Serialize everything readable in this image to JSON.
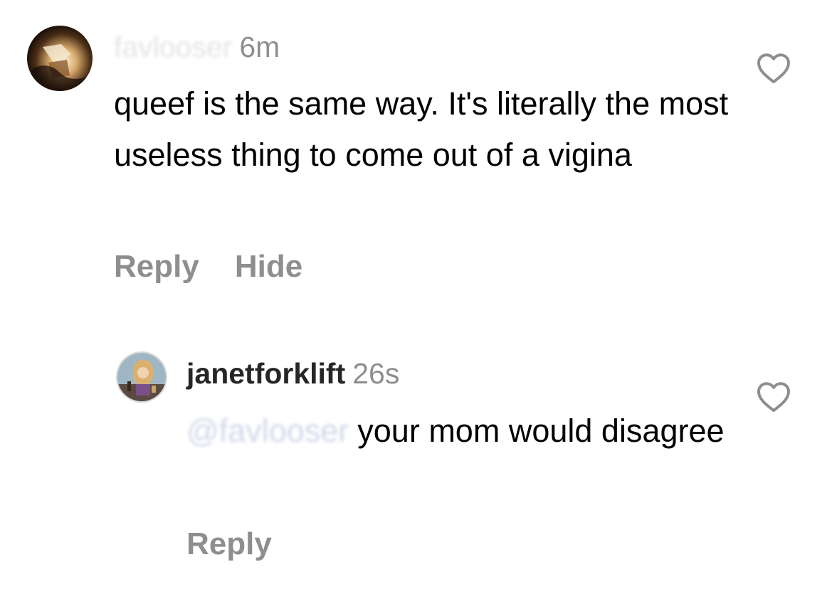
{
  "comments": [
    {
      "username": "favlooser",
      "timestamp": "6m",
      "text": "queef is the same way. It's literally the most useless thing to come out of a vigina",
      "reply_label": "Reply",
      "hide_label": "Hide",
      "avatar_icon": "avatar-photo",
      "like_icon": "heart-outline-icon"
    },
    {
      "username": "janetforklift",
      "timestamp": "26s",
      "mention": "@favlooser",
      "text": "your mom would disagree",
      "reply_label": "Reply",
      "avatar_icon": "avatar-photo",
      "like_icon": "heart-outline-icon"
    }
  ],
  "colors": {
    "secondary_text": "#8e8e8e",
    "primary_text": "#000000",
    "username_text": "#262626",
    "background": "#ffffff"
  }
}
